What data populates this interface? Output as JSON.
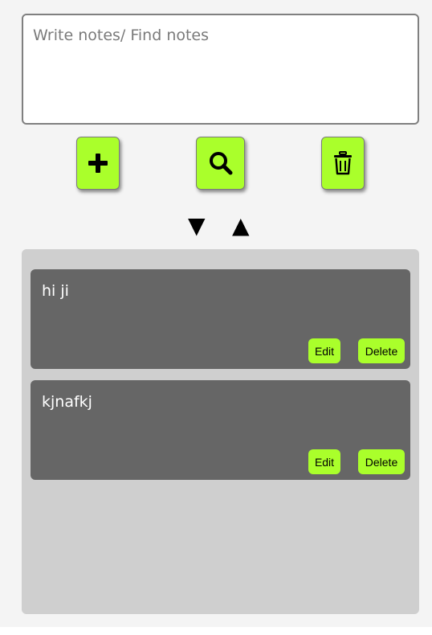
{
  "input": {
    "placeholder": "Write notes/ Find notes",
    "value": ""
  },
  "toolbar": {
    "add_icon": "plus-icon",
    "search_icon": "magnifier-icon",
    "clear_icon": "trash-icon"
  },
  "sort": {
    "desc_label": "▼",
    "asc_label": "▲"
  },
  "notes": [
    {
      "text": "hi ji",
      "edit_label": "Edit",
      "delete_label": "Delete"
    },
    {
      "text": "kjnafkj",
      "edit_label": "Edit",
      "delete_label": "Delete"
    }
  ],
  "colors": {
    "accent": "#aaff2b",
    "card_bg": "#666666",
    "panel_bg": "#cfcfcf",
    "page_bg": "#f4f4f4"
  }
}
